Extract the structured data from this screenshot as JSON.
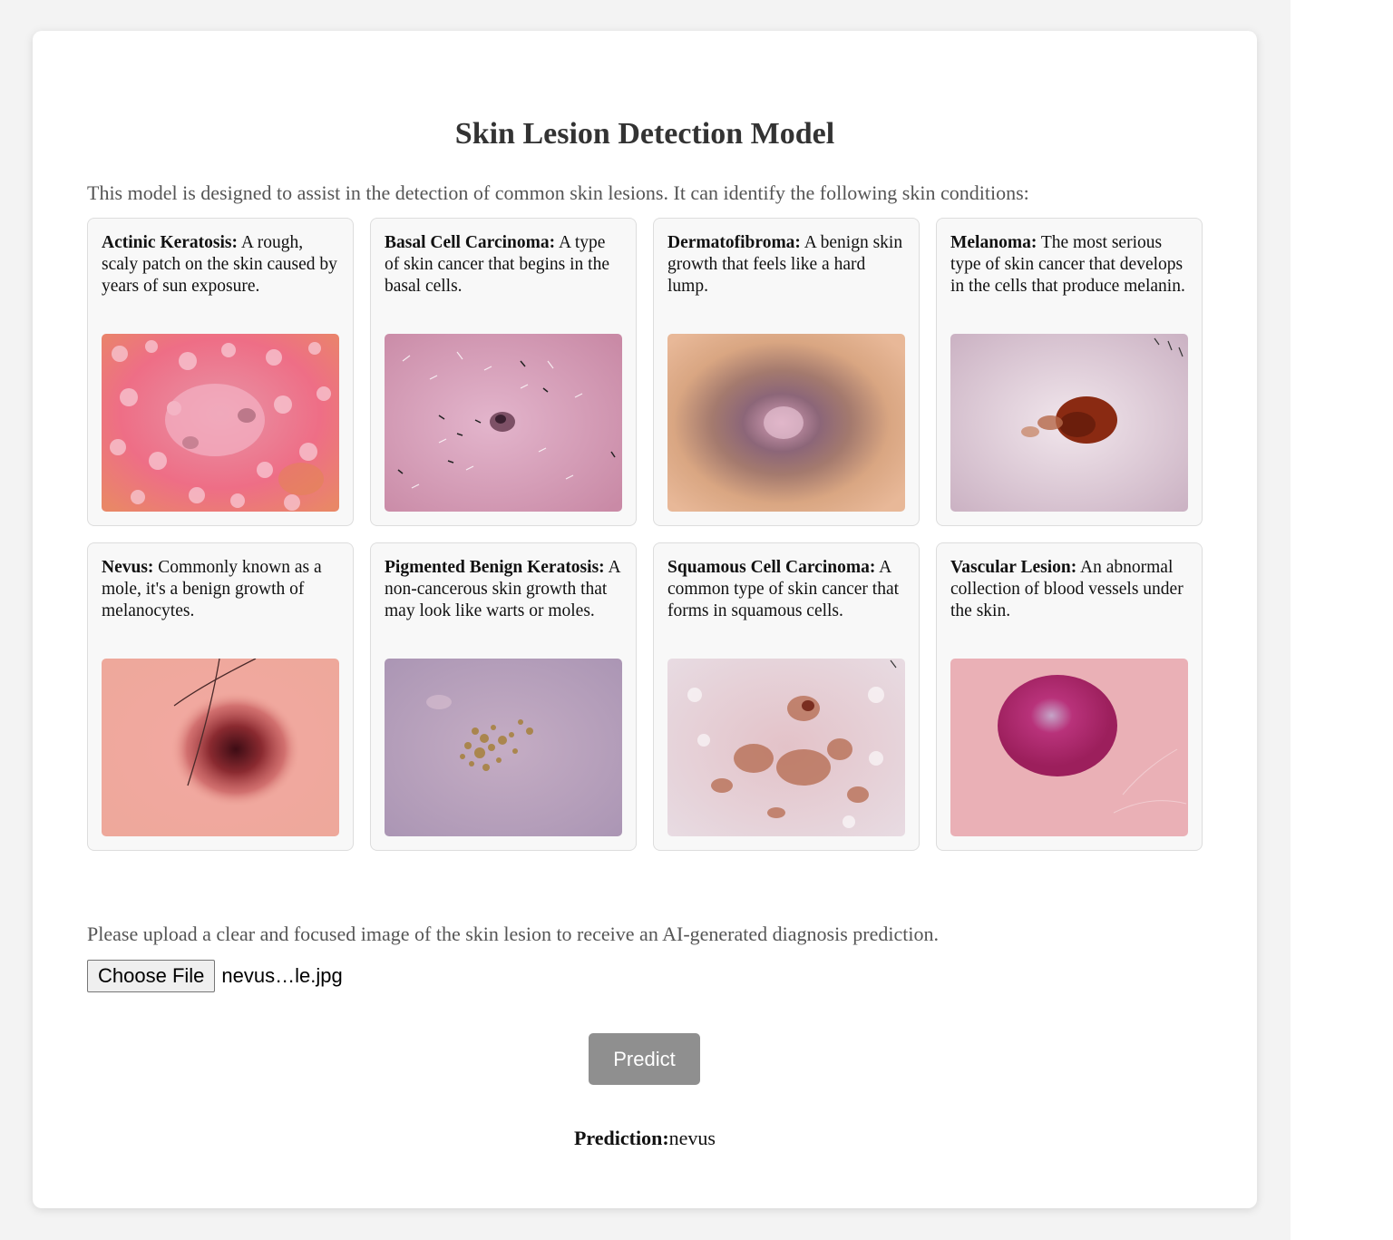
{
  "page": {
    "title": "Skin Lesion Detection Model",
    "intro": "This model is designed to assist in the detection of common skin lesions. It can identify the following skin conditions:",
    "upload_instructions": "Please upload a clear and focused image of the skin lesion to receive an AI-generated diagnosis prediction."
  },
  "lesions": [
    {
      "name": "Actinic Keratosis:",
      "description": " A rough, scaly patch on the skin caused by years of sun exposure."
    },
    {
      "name": "Basal Cell Carcinoma:",
      "description": " A type of skin cancer that begins in the basal cells."
    },
    {
      "name": "Dermatofibroma:",
      "description": " A benign skin growth that feels like a hard lump."
    },
    {
      "name": "Melanoma:",
      "description": " The most serious type of skin cancer that develops in the cells that produce melanin."
    },
    {
      "name": "Nevus:",
      "description": " Commonly known as a mole, it's a benign growth of melanocytes."
    },
    {
      "name": "Pigmented Benign Keratosis:",
      "description": " A non-cancerous skin growth that may look like warts or moles."
    },
    {
      "name": "Squamous Cell Carcinoma:",
      "description": " A common type of skin cancer that forms in squamous cells."
    },
    {
      "name": "Vascular Lesion:",
      "description": " An abnormal collection of blood vessels under the skin."
    }
  ],
  "upload": {
    "button_label": "Choose File",
    "file_name": "nevus…le.jpg"
  },
  "predict_button": "Predict",
  "prediction": {
    "label": "Prediction:",
    "value": "nevus"
  },
  "colors": {
    "page_background": "#f3f3f3",
    "card_background": "#ffffff",
    "lesion_card_background": "#f8f8f8",
    "predict_button": "#8f8f8f"
  }
}
